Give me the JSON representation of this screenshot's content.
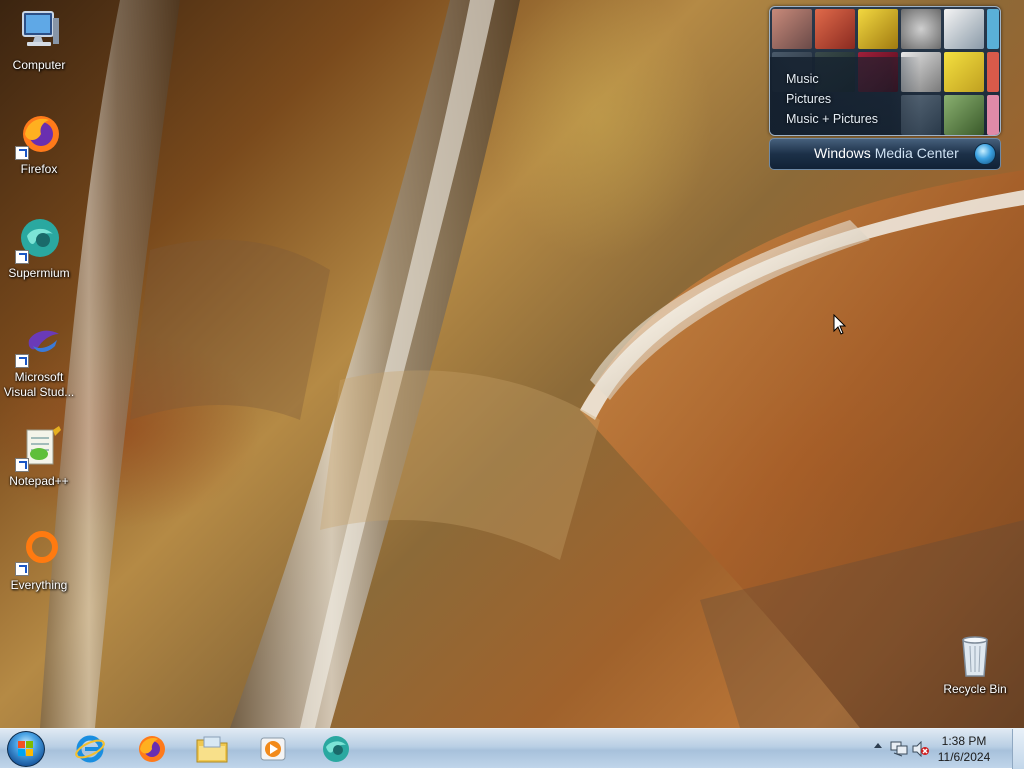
{
  "desktop": {
    "icons": [
      {
        "label": "Computer",
        "icon": "computer-icon"
      },
      {
        "label": "Firefox",
        "icon": "firefox-icon"
      },
      {
        "label": "Supermium",
        "icon": "supermium-icon"
      },
      {
        "label_line1": "Microsoft",
        "label_line2": "Visual Stud...",
        "icon": "visual-studio-icon"
      },
      {
        "label": "Notepad++",
        "icon": "notepad-plus-plus-icon"
      },
      {
        "label": "Everything",
        "icon": "everything-search-icon"
      }
    ],
    "recycle_bin": {
      "label": "Recycle Bin",
      "icon": "recycle-bin-icon"
    }
  },
  "gadget": {
    "menu": [
      "Music",
      "Pictures",
      "Music + Pictures"
    ],
    "title_bold": "Windows",
    "title_light": "Media Center"
  },
  "taskbar": {
    "pinned": [
      {
        "name": "internet-explorer-icon"
      },
      {
        "name": "firefox-icon"
      },
      {
        "name": "file-explorer-icon"
      },
      {
        "name": "media-player-icon"
      },
      {
        "name": "supermium-icon"
      }
    ],
    "clock": {
      "time": "1:38 PM",
      "date": "11/6/2024"
    }
  },
  "colors": {
    "taskbar_top": "#dfe9f3",
    "taskbar_bottom": "#a7c1db",
    "label_text": "#ffffff",
    "gadget_bg": "#1a2736"
  }
}
